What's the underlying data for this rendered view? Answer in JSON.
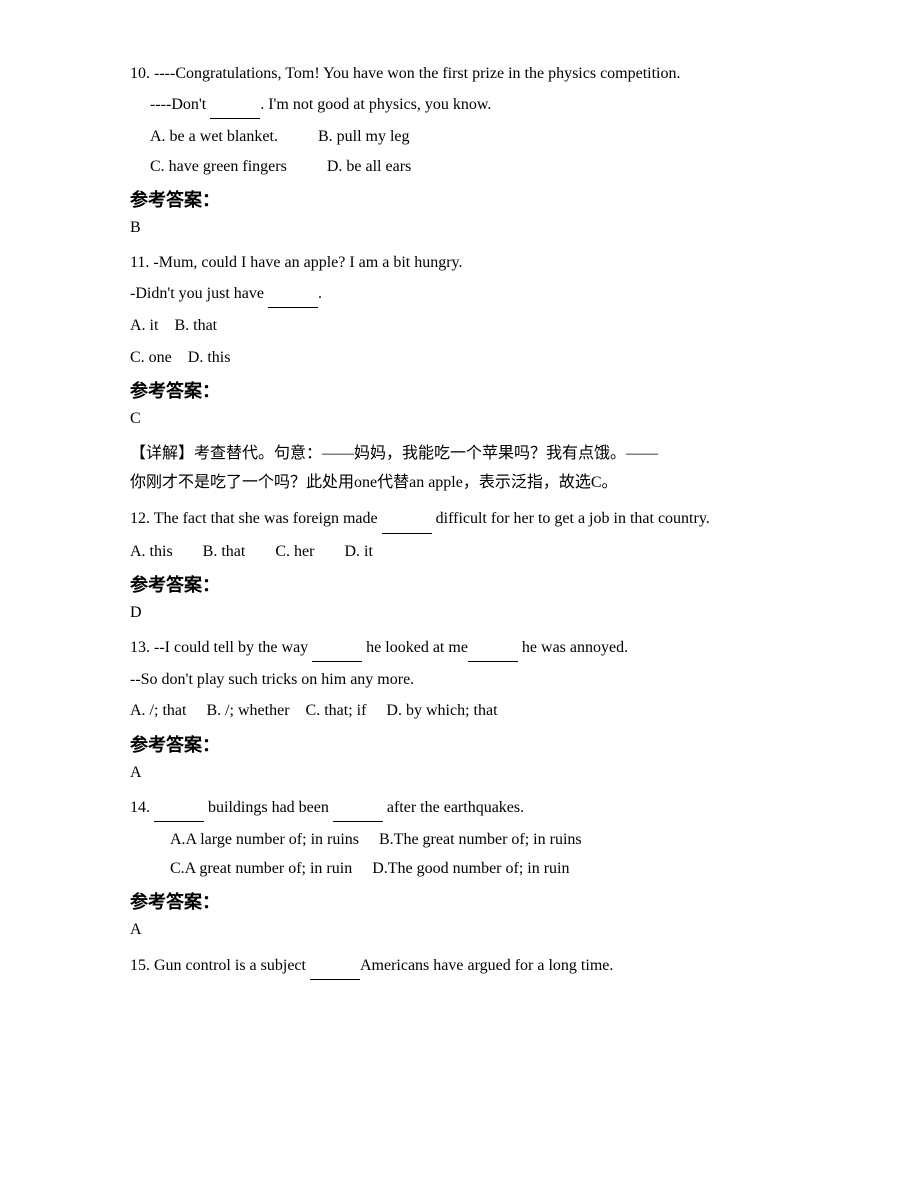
{
  "questions": [
    {
      "number": "10",
      "lines": [
        "10. ----Congratulations, Tom! You have won the first prize in the physics competition.",
        "  ----Don't _____. I'm not good at physics, you know."
      ],
      "options": [
        {
          "label": "A.",
          "text": "be a wet blanket."
        },
        {
          "label": "B.",
          "text": "pull my leg"
        },
        {
          "label": "C.",
          "text": "have green fingers"
        },
        {
          "label": "D.",
          "text": "be all ears"
        }
      ],
      "answer_label": "参考答案：",
      "answer": "B"
    },
    {
      "number": "11",
      "lines": [
        "11. -Mum, could I have an apple? I am a bit hungry.",
        "-Didn't you just have _____."
      ],
      "options_inline": "A. it   B. that",
      "options_inline2": "C. one   D. this",
      "answer_label": "参考答案：",
      "answer": "C",
      "explanation_lines": [
        "【详解】考查替代。句意：——妈妈，我能吃一个苹果吗？我有点饿。——",
        "你刚才不是吃了一个吗？此处用one代替an apple，表示泛指，故选C。"
      ]
    },
    {
      "number": "12",
      "lines": [
        "12. The fact that she was foreign made ______ difficult for her to get a job in that country."
      ],
      "options_four": [
        {
          "label": "A. this",
          "text": ""
        },
        {
          "label": "B. that",
          "text": ""
        },
        {
          "label": "C. her",
          "text": ""
        },
        {
          "label": "D. it",
          "text": ""
        }
      ],
      "answer_label": "参考答案：",
      "answer": "D"
    },
    {
      "number": "13",
      "lines": [
        "13. --I could tell by the way ____ he looked at me____ he was annoyed.",
        "--So don't play such tricks on him any more."
      ],
      "options_inline_13": "A. /; that     B. /; whether    C. that; if     D. by which; that",
      "answer_label": "参考答案：",
      "answer": "A"
    },
    {
      "number": "14",
      "lines": [
        "14. ______ buildings had been ______ after the earthquakes."
      ],
      "options_14a": "A.A large number of; in ruins     B.The great number of; in ruins",
      "options_14b": "C.A great number of; in ruin      D.The good number of; in ruin",
      "answer_label": "参考答案：",
      "answer": "A"
    },
    {
      "number": "15",
      "lines": [
        "15. Gun control is a subject ________Americans have argued for a long time."
      ]
    }
  ]
}
